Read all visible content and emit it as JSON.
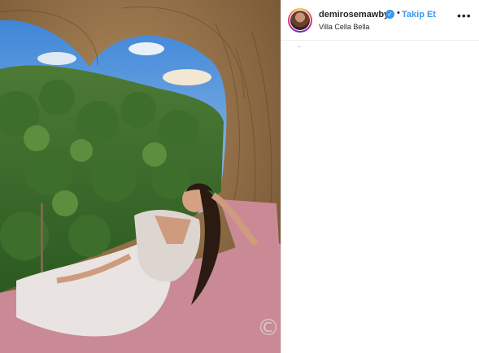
{
  "post": {
    "image_alt": "Woman lounging in a woven heart-shaped nest overlooking a jungle"
  },
  "header": {
    "username": "demirosemawby",
    "verified_icon": "verified-badge-icon",
    "separator": "•",
    "follow_label": "Takip Et",
    "location": "Villa Cella Bella",
    "more_label": "•••"
  },
  "colors": {
    "accent": "#3897f0",
    "text": "#262626",
    "border": "#efefef"
  }
}
